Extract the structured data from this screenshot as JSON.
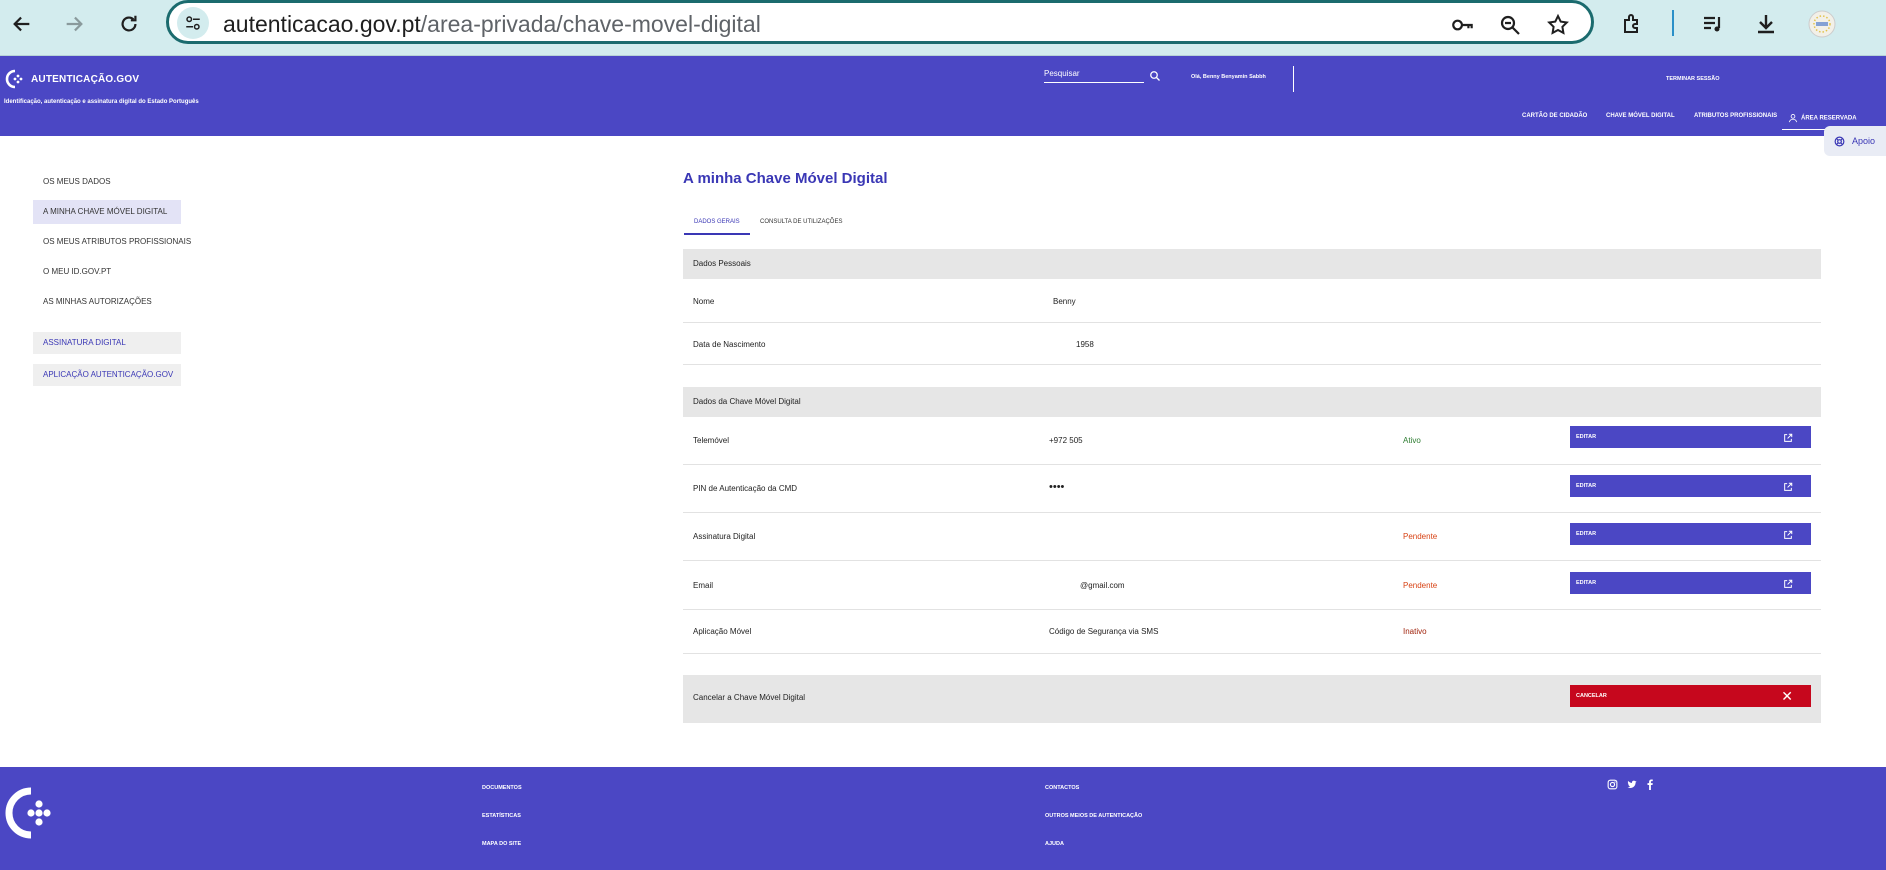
{
  "browser": {
    "url_host": "autenticacao.gov.pt",
    "url_path": "/area-privada/chave-movel-digital"
  },
  "header": {
    "logo_text": "AUTENTICAÇÃO.GOV",
    "tagline": "Identificação, autenticação e assinatura digital do Estado Português",
    "search_placeholder": "Pesquisar",
    "greeting": "Olá, Benny Benyamin Sabbh",
    "logout": "TERMINAR SESSÃO",
    "nav": [
      "CARTÃO DE CIDADÃO",
      "CHAVE MÓVEL DIGITAL",
      "ATRIBUTOS PROFISSIONAIS",
      "ÁREA RESERVADA"
    ]
  },
  "apoio": "Apoio",
  "sidebar": {
    "items": [
      "OS MEUS DADOS",
      "A MINHA CHAVE MÓVEL DIGITAL",
      "OS MEUS ATRIBUTOS PROFISSIONAIS",
      "O MEU ID.GOV.PT",
      "AS MINHAS AUTORIZAÇÕES"
    ],
    "boxed": [
      "ASSINATURA DIGITAL",
      "APLICAÇÃO AUTENTICAÇÃO.GOV"
    ]
  },
  "main": {
    "title": "A minha Chave Móvel Digital",
    "tabs": [
      "DADOS GERAIS",
      "CONSULTA DE UTILIZAÇÕES"
    ],
    "personal": {
      "heading": "Dados Pessoais",
      "name_label": "Nome",
      "name_value": "Benny",
      "birth_label": "Data de Nascimento",
      "birth_value": "1958"
    },
    "cmd": {
      "heading": "Dados da Chave Móvel Digital",
      "rows": [
        {
          "label": "Telemóvel",
          "value": "+972 505",
          "status": "Ativo",
          "button": "EDITAR"
        },
        {
          "label": "PIN de Autenticação da CMD",
          "value": "••••",
          "status": "",
          "button": "EDITAR"
        },
        {
          "label": "Assinatura Digital",
          "value": "",
          "status": "Pendente",
          "button": "EDITAR"
        },
        {
          "label": "Email",
          "value": "@gmail.com",
          "status": "Pendente",
          "button": "EDITAR"
        },
        {
          "label": "Aplicação Móvel",
          "value": "Código de Segurança via SMS",
          "status": "Inativo",
          "button": ""
        }
      ]
    },
    "cancel": {
      "label": "Cancelar a Chave Móvel Digital",
      "button": "CANCELAR"
    }
  },
  "footer": {
    "col1": [
      "DOCUMENTOS",
      "ESTATÍSTICAS",
      "MAPA DO SITE"
    ],
    "col2": [
      "CONTACTOS",
      "OUTROS MEIOS DE AUTENTICAÇÃO",
      "AJUDA"
    ],
    "social_icons": [
      "instagram-icon",
      "twitter-icon",
      "facebook-icon"
    ]
  },
  "colors": {
    "brand": "#4b47c4",
    "danger": "#c6071d",
    "active": "#2e7d32",
    "pending": "#d84315"
  }
}
